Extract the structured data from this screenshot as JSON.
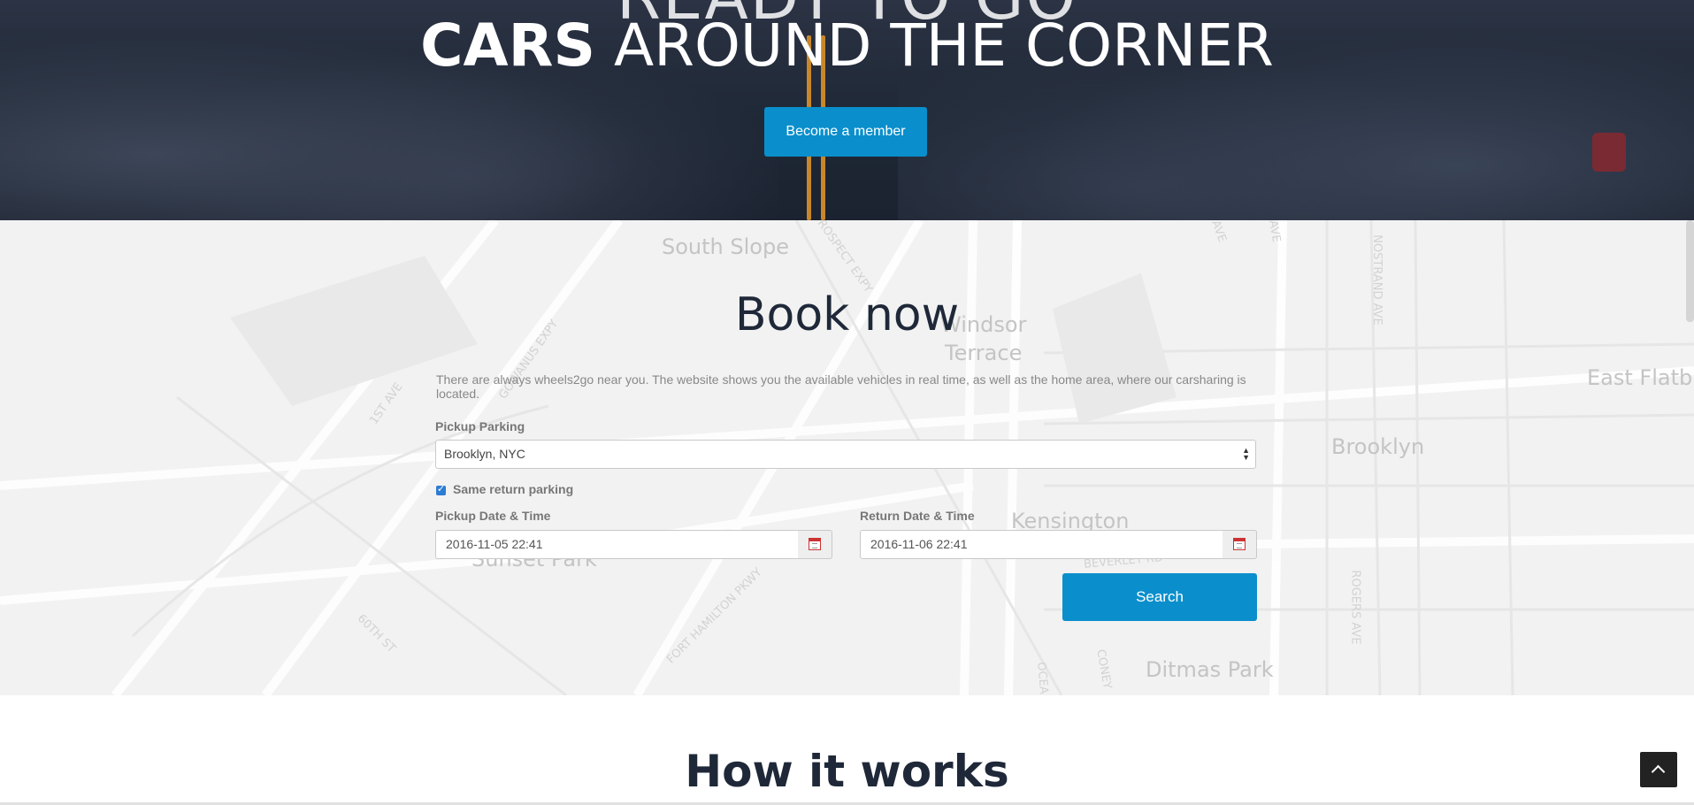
{
  "hero": {
    "title_top_fragment": "READY TO GO",
    "title_strong": "CARS",
    "title_light": " AROUND THE CORNER",
    "member_button": "Become a member"
  },
  "map": {
    "labels": [
      "South Slope",
      "Windsor",
      "Terrace",
      "Brooklyn",
      "East Flatb",
      "Kensington",
      "Sunset Park",
      "Ditmas Park"
    ],
    "street_labels": [
      "PROSPECT EXPY",
      "GOWANUS EXPY",
      "1ST AVE",
      "60TH ST",
      "FORT HAMILTON PKWY",
      "NOSTRAND AVE",
      "ROGERS AVE",
      "BEVERLEY RD",
      "CONEY",
      "OCEA",
      "AVE",
      "AVE"
    ]
  },
  "booking": {
    "title": "Book now",
    "description": "There are always wheels2go near you. The website shows you the available vehicles in real time, as well as the home area, where our carsharing is located.",
    "pickup_parking_label": "Pickup Parking",
    "pickup_parking_value": "Brooklyn, NYC",
    "same_return_label": "Same return parking",
    "same_return_checked": true,
    "pickup_datetime_label": "Pickup Date & Time",
    "pickup_datetime_value": "2016-11-05 22:41",
    "return_datetime_label": "Return Date & Time",
    "return_datetime_value": "2016-11-06 22:41",
    "search_button": "Search"
  },
  "how": {
    "title": "How it works"
  },
  "colors": {
    "accent": "#0a8fcc",
    "heading": "#1e2838",
    "map_bg": "#f2f2f2"
  }
}
